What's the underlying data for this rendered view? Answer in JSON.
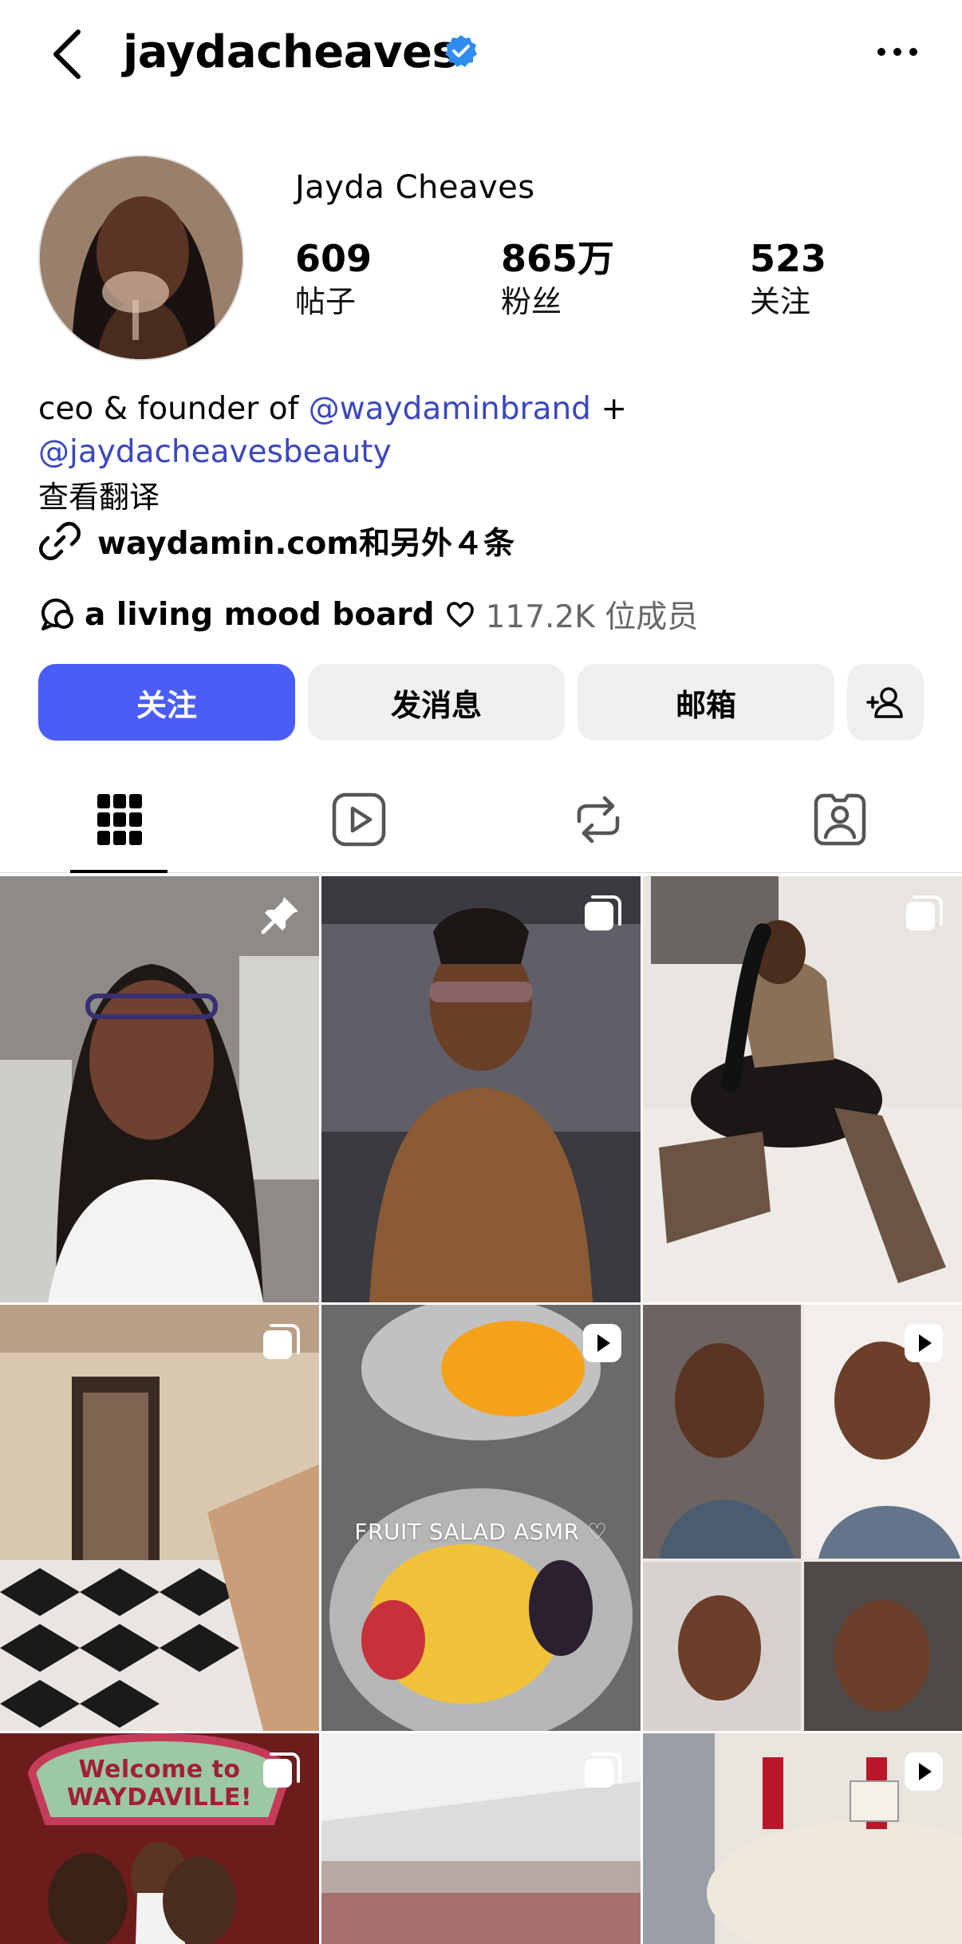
{
  "header": {
    "username": "jaydacheaves",
    "back_icon": "chevron-left-icon",
    "verified_icon": "verified-badge-icon",
    "more_icon": "more-horizontal-icon"
  },
  "profile": {
    "full_name": "Jayda Cheaves",
    "stats": [
      {
        "value": "609",
        "label": "帖子"
      },
      {
        "value": "865万",
        "label": "粉丝"
      },
      {
        "value": "523",
        "label": "关注"
      }
    ],
    "bio_prefix": "ceo & founder of ",
    "bio_mention_1": "@waydaminbrand",
    "bio_plus": " +",
    "bio_mention_2": "@jaydacheavesbeauty",
    "translate": "查看翻译",
    "link": "waydamin.com和另外４条",
    "channel_name": "a living mood board",
    "channel_members": "117.2K 位成员"
  },
  "actions": {
    "follow": "关注",
    "message": "发消息",
    "email": "邮箱",
    "add_person_icon": "add-person-icon"
  },
  "tabs": [
    {
      "name": "grid",
      "icon": "grid-icon"
    },
    {
      "name": "reels",
      "icon": "reels-icon"
    },
    {
      "name": "reposts",
      "icon": "repost-icon"
    },
    {
      "name": "tagged",
      "icon": "tagged-icon"
    }
  ],
  "grid": {
    "posts": [
      {
        "badge": "pin-icon"
      },
      {
        "badge": "carousel-icon"
      },
      {
        "badge": "carousel-icon"
      },
      {
        "badge": "carousel-icon"
      },
      {
        "badge": "reel-icon",
        "caption": "FRUIT SALAD ASMR ♡"
      },
      {
        "badge": "reel-icon"
      },
      {
        "badge": "carousel-icon",
        "sign": "Welcome to WAYDAVILLE!"
      },
      {
        "badge": "carousel-icon"
      },
      {
        "badge": "reel-icon"
      }
    ]
  },
  "colors": {
    "accent": "#4a5df9",
    "mention": "#3a47c0",
    "verified": "#2f8cf0",
    "button_bg": "#efefef"
  }
}
